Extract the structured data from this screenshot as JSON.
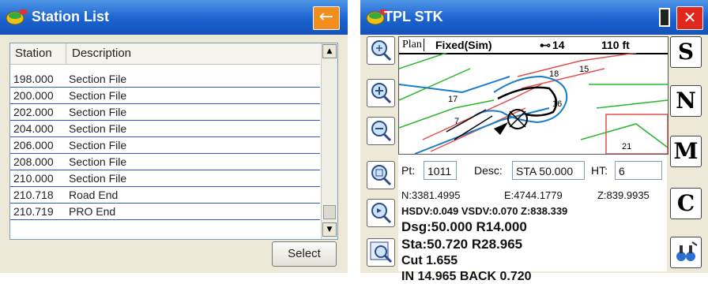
{
  "left": {
    "title": "Station List",
    "back_icon": "←",
    "columns": [
      "Station",
      "Description"
    ],
    "rows": [
      {
        "station": "198.000",
        "description": "Section File"
      },
      {
        "station": "200.000",
        "description": "Section File"
      },
      {
        "station": "202.000",
        "description": "Section File"
      },
      {
        "station": "204.000",
        "description": "Section File"
      },
      {
        "station": "206.000",
        "description": "Section File"
      },
      {
        "station": "208.000",
        "description": "Section File"
      },
      {
        "station": "210.000",
        "description": "Section File"
      },
      {
        "station": "210.718",
        "description": "Road End"
      },
      {
        "station": "210.719",
        "description": "PRO End"
      }
    ],
    "select_label": "Select"
  },
  "right": {
    "title": "TPL STK",
    "close_icon": "✕",
    "map": {
      "view": "Plan",
      "fix": "Fixed(Sim)",
      "sats": "14",
      "scale": "110 ft",
      "labels": [
        "18",
        "15",
        "17",
        "16",
        "7",
        "21"
      ]
    },
    "pt_label": "Pt:",
    "pt_value": "1011",
    "desc_label": "Desc:",
    "desc_value": "STA 50.000",
    "ht_label": "HT:",
    "ht_value": "6",
    "coords": {
      "n": "N:3381.4995",
      "e": "E:4744.1779",
      "z": "Z:839.9935"
    },
    "hsdv": "HSDV:0.049 VSDV:0.070 Z:838.339",
    "dsg": "Dsg:50.000 R14.000",
    "sta": "Sta:50.720 R28.965",
    "cut": "Cut 1.655",
    "inback": "IN 14.965 BACK 0.720",
    "side_buttons": [
      "S",
      "N",
      "M",
      "C"
    ],
    "tool_icons": [
      "zoom-extents-icon",
      "zoom-in-icon",
      "zoom-out-icon",
      "zoom-window-icon",
      "zoom-previous-icon",
      "zoom-center-icon"
    ]
  },
  "colors": {
    "titlebar": "#1a62cf",
    "back_button": "#f28d1e",
    "close_button": "#e0281e",
    "row_line": "#2f58c8"
  }
}
